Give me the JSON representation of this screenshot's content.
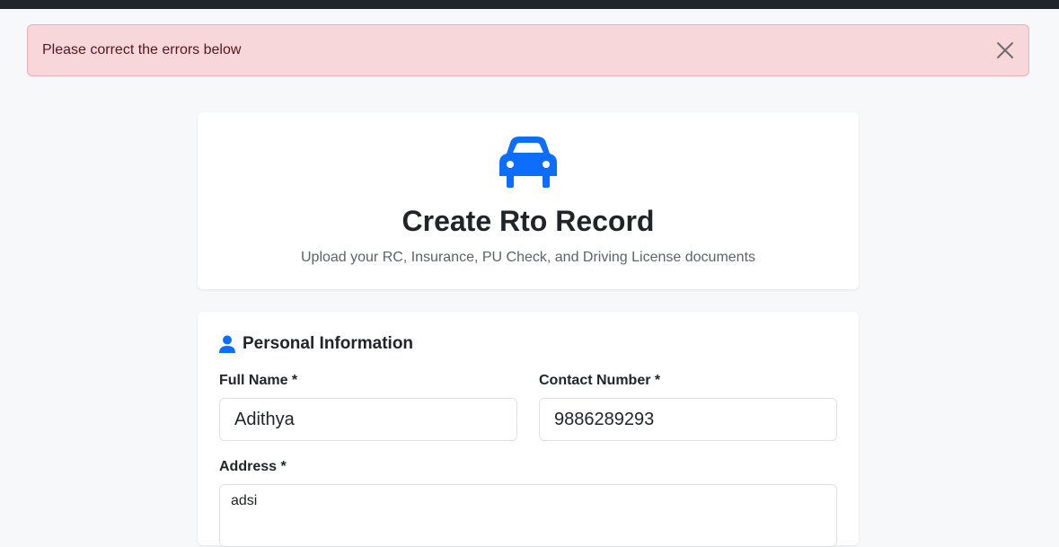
{
  "alert": {
    "message": "Please correct the errors below",
    "close_icon": "close-icon",
    "color": "#f8d7da"
  },
  "header": {
    "icon": "car-icon",
    "title": "Create Rto Record",
    "subtitle": "Upload your RC, Insurance, PU Check, and Driving License documents",
    "accent_color": "#0d6efd"
  },
  "personal": {
    "icon": "person-icon",
    "title": "Personal Information",
    "full_name": {
      "label": "Full Name *",
      "value": "Adithya"
    },
    "contact": {
      "label": "Contact Number *",
      "value": "9886289293"
    },
    "address": {
      "label": "Address *",
      "value": "adsi"
    }
  }
}
